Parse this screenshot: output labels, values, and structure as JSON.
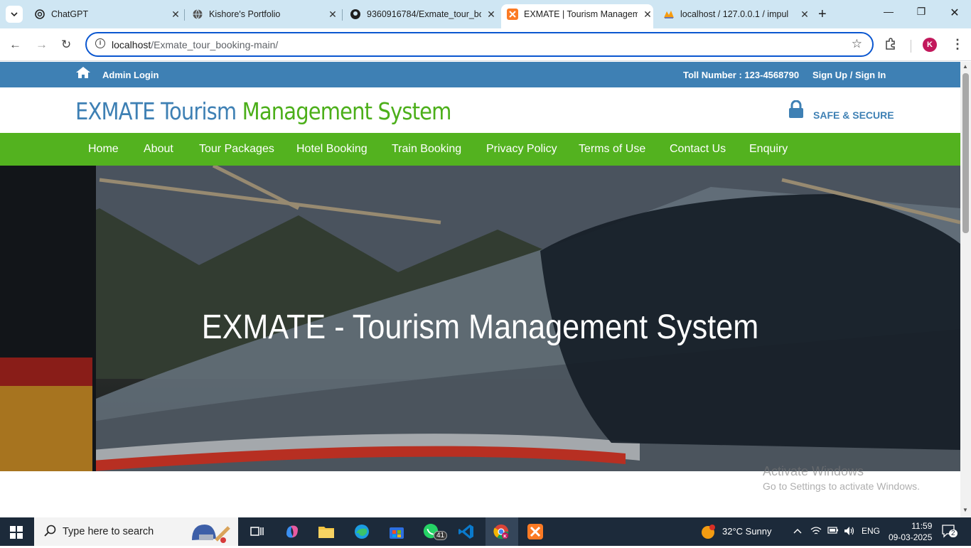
{
  "browser": {
    "tabs": [
      {
        "title": "ChatGPT",
        "icon": "chatgpt-icon"
      },
      {
        "title": "Kishore's Portfolio",
        "icon": "globe-icon"
      },
      {
        "title": "9360916784/Exmate_tour_bo",
        "icon": "github-icon"
      },
      {
        "title": "EXMATE | Tourism Managem",
        "icon": "xampp-icon"
      },
      {
        "title": "localhost / 127.0.0.1 / impul",
        "icon": "phpmyadmin-icon"
      }
    ],
    "address": {
      "host": "localhost",
      "path": "/Exmate_tour_booking-main/"
    },
    "profile_initial": "K"
  },
  "site": {
    "topbar": {
      "admin_login": "Admin Login",
      "toll_number": "Toll Number : 123-4568790",
      "signup": "Sign Up / Sign In"
    },
    "brand": {
      "part1": "EXMATE Tourism",
      "part2": "Management System"
    },
    "safe_secure": "SAFE & SECURE",
    "menu": [
      "Home",
      "About",
      "Tour Packages",
      "Hotel Booking",
      "Train Booking",
      "Privacy Policy",
      "Terms of Use",
      "Contact Us",
      "Enquiry"
    ],
    "hero_title": "EXMATE - Tourism Management System"
  },
  "watermark": {
    "line1": "Activate Windows",
    "line2": "Go to Settings to activate Windows."
  },
  "taskbar": {
    "search_placeholder": "Type here to search",
    "whatsapp_badge": "41",
    "weather": "32°C  Sunny",
    "lang": "ENG",
    "time": "11:59",
    "date": "09-03-2025",
    "notifications": "2"
  },
  "colors": {
    "topbar": "#3e80b4",
    "menubar": "#53b21f",
    "brand_blue": "#3e80b4",
    "brand_green": "#4caf1a"
  }
}
